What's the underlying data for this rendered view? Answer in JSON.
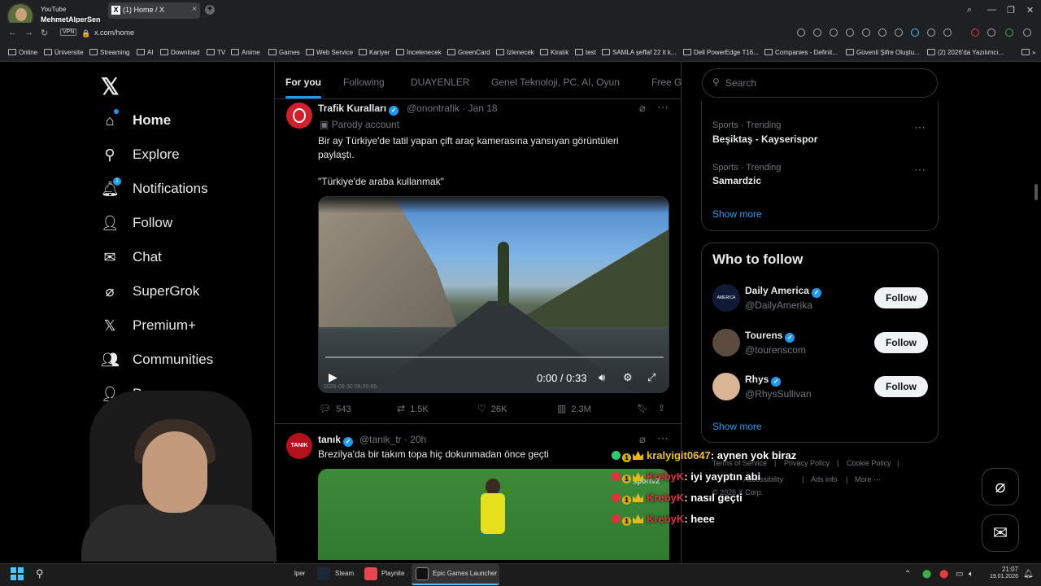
{
  "browser": {
    "profile_top": "YouTube",
    "profile_name": "MehmetAlperSen",
    "tab_title": "(1) Home / X",
    "address": "x.com/home",
    "vpn": "VPN",
    "bookmarks": [
      "Online",
      "Üniversite",
      "Streaming",
      "AI",
      "Download",
      "TV",
      "Anime",
      "Games",
      "Web Service",
      "Kariyer",
      "İncelenecek",
      "GreenCard",
      "İzlenecek",
      "Kiralık",
      "test",
      "SAMLA şeffaf 22 lt k...",
      "Dell PowerEdge T16...",
      "Companies - Definit...",
      "Güvenli Şifre Oluştu...",
      "(2) 2026'da Yazılımcı..."
    ]
  },
  "nav": {
    "home": "Home",
    "explore": "Explore",
    "notifications": "Notifications",
    "notif_count": "1",
    "follow": "Follow",
    "chat": "Chat",
    "supergrok": "SuperGrok",
    "premium": "Premium+",
    "communities": "Communities",
    "profile_partial": "P"
  },
  "feed_tabs": [
    "For you",
    "Following",
    "DUAYENLER",
    "Genel Teknoloji, PC, AI, Oyun",
    "Free G"
  ],
  "tweet1": {
    "name": "Trafik Kuralları",
    "handle": "@onontrafik · Jan 18",
    "parody": "Parody account",
    "text1": "Bir ay Türkiye'de tatil yapan çift araç kamerasına yansıyan görüntüleri",
    "text2": "paylaştı.",
    "quote": "\"Türkiye'de araba kullanmak\"",
    "video_time": "0:00 / 0:33",
    "video_progress": 0,
    "stamp": "2026-09-30 09:20:66",
    "replies": "543",
    "reposts": "1.5K",
    "likes": "26K",
    "views": "2.3M"
  },
  "tweet2": {
    "name": "tanık",
    "handle": "@tanik_tr · 20h",
    "text": "Brezilya'da bir takım topa hiç dokunmadan önce geçti",
    "avatar_text": "TANIK",
    "video_logo": "sportv2"
  },
  "search": {
    "placeholder": "Search"
  },
  "trends": [
    {
      "category": "Sports · Trending",
      "title": "Beşiktaş - Kayserispor"
    },
    {
      "category": "Sports · Trending",
      "title": "Samardzic"
    }
  ],
  "show_more": "Show more",
  "who_to_follow": {
    "title": "Who to follow",
    "items": [
      {
        "name": "Daily America",
        "handle": "@DailyAmerika",
        "button": "Follow"
      },
      {
        "name": "Tourens",
        "handle": "@tourenscom",
        "button": "Follow"
      },
      {
        "name": "Rhys",
        "handle": "@RhysSullivan",
        "button": "Follow"
      }
    ],
    "show_more": "Show more"
  },
  "footer": [
    "Terms of Service",
    "|",
    "Privacy Policy",
    "|",
    "Cookie Policy",
    "|",
    "Accessibility",
    "|",
    "Ads info",
    "|",
    "More ···",
    "© 2026 X Corp."
  ],
  "chat": [
    {
      "user": "kralyigit0647",
      "message": ": aynen yok biraz",
      "color": "#f0c419"
    },
    {
      "user": "KrebyK",
      "message": ": iyi yayptın abi",
      "color": "#e0323c"
    },
    {
      "user": "KrebyK",
      "message": ": nasıl geçti",
      "color": "#e0323c"
    },
    {
      "user": "KrebyK",
      "message": ": heee",
      "color": "#e0323c"
    }
  ],
  "taskbar": {
    "items": [
      "lper",
      "Steam",
      "Playnite",
      "Epic Games Launcher"
    ],
    "time": "21:07",
    "date": "19.01.2026"
  },
  "colors": {
    "accent": "#1d9bf0",
    "bg": "#000000",
    "border": "#2f3336"
  }
}
